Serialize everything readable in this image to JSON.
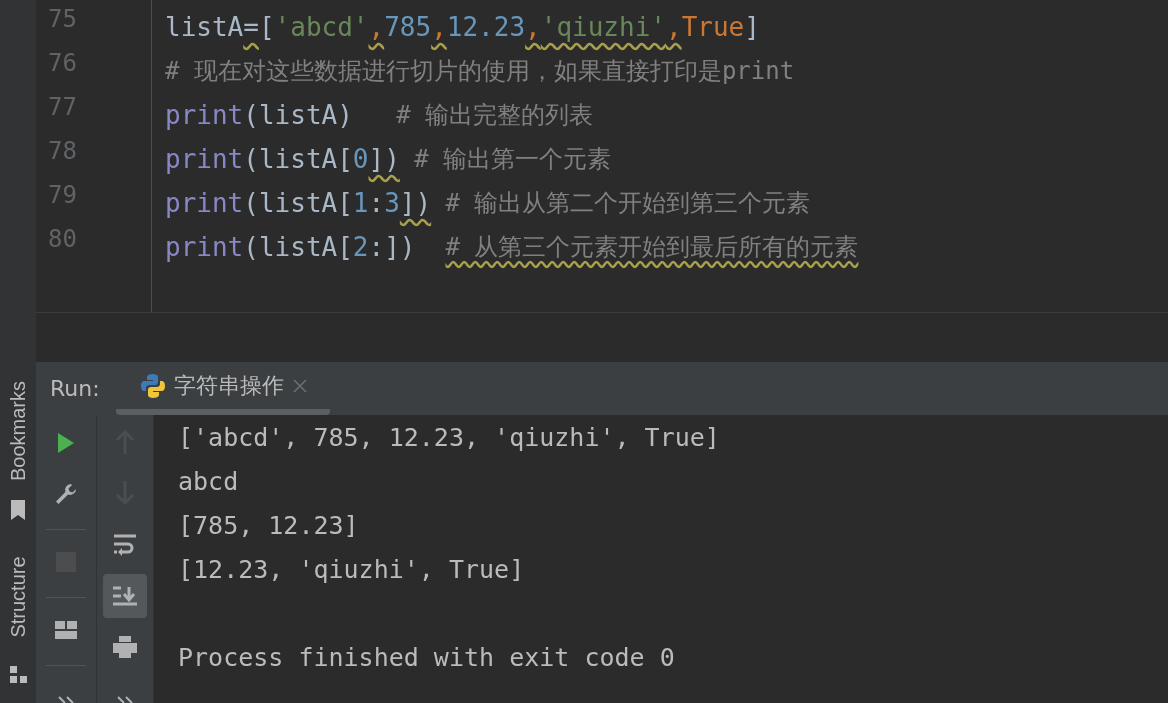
{
  "editor": {
    "lines": [
      {
        "number": "75",
        "tokens": [
          {
            "text": "listA",
            "kind": "plain",
            "warn": false
          },
          {
            "text": "=",
            "kind": "plain",
            "warn": true
          },
          {
            "text": "[",
            "kind": "plain",
            "warn": false
          },
          {
            "text": "'abcd'",
            "kind": "string",
            "warn": false
          },
          {
            "text": ",",
            "kind": "punct",
            "warn": true
          },
          {
            "text": "785",
            "kind": "number",
            "warn": false
          },
          {
            "text": ",",
            "kind": "punct",
            "warn": true
          },
          {
            "text": "12.23",
            "kind": "number",
            "warn": false
          },
          {
            "text": ",",
            "kind": "punct",
            "warn": true
          },
          {
            "text": "'qiuzhi'",
            "kind": "string",
            "warn": true
          },
          {
            "text": ",",
            "kind": "punct",
            "warn": true
          },
          {
            "text": "True",
            "kind": "const",
            "warn": false
          },
          {
            "text": "]",
            "kind": "plain",
            "warn": false
          }
        ]
      },
      {
        "number": "76",
        "tokens": [
          {
            "text": "# 现在对这些数据进行切片的使用，如果直接打印是print",
            "kind": "comment",
            "warn": false
          }
        ]
      },
      {
        "number": "77",
        "tokens": [
          {
            "text": "print",
            "kind": "keyword",
            "warn": false
          },
          {
            "text": "(listA)",
            "kind": "plain",
            "warn": false
          },
          {
            "text": "   # 输出完整的列表",
            "kind": "comment",
            "warn": false
          }
        ]
      },
      {
        "number": "78",
        "tokens": [
          {
            "text": "print",
            "kind": "keyword",
            "warn": false
          },
          {
            "text": "(listA[",
            "kind": "plain",
            "warn": false
          },
          {
            "text": "0",
            "kind": "number",
            "warn": false
          },
          {
            "text": "])",
            "kind": "plain",
            "warn": true
          },
          {
            "text": " # 输出第一个元素",
            "kind": "comment",
            "warn": false
          }
        ]
      },
      {
        "number": "79",
        "tokens": [
          {
            "text": "print",
            "kind": "keyword",
            "warn": false
          },
          {
            "text": "(listA[",
            "kind": "plain",
            "warn": false
          },
          {
            "text": "1",
            "kind": "number",
            "warn": false
          },
          {
            "text": ":",
            "kind": "plain",
            "warn": false
          },
          {
            "text": "3",
            "kind": "number",
            "warn": false
          },
          {
            "text": "])",
            "kind": "plain",
            "warn": true
          },
          {
            "text": " # 输出从第二个开始到第三个元素",
            "kind": "comment",
            "warn": false
          }
        ]
      },
      {
        "number": "80",
        "tokens": [
          {
            "text": "print",
            "kind": "keyword",
            "warn": false
          },
          {
            "text": "(listA[",
            "kind": "plain",
            "warn": false
          },
          {
            "text": "2",
            "kind": "number",
            "warn": false
          },
          {
            "text": ":])",
            "kind": "plain",
            "warn": false
          },
          {
            "text": "# 从第三个元素开始到最后所有的元素",
            "kind": "comment",
            "warn": true
          }
        ]
      }
    ]
  },
  "side_tabs": [
    {
      "label": "Bookmarks",
      "kind": "bookmark"
    },
    {
      "label": "Structure",
      "kind": "structure"
    }
  ],
  "run": {
    "title": "Run:",
    "tabs": [
      {
        "label": "字符串操作",
        "selected": true
      }
    ],
    "toolbar_1": [
      {
        "kind": "run",
        "disabled": false,
        "pressed": false
      },
      {
        "kind": "wrench",
        "disabled": false,
        "pressed": false
      },
      {
        "kind": "separator"
      },
      {
        "kind": "stop",
        "disabled": true,
        "pressed": false
      },
      {
        "kind": "separator"
      },
      {
        "kind": "layout",
        "disabled": false,
        "pressed": false
      },
      {
        "kind": "separator"
      },
      {
        "kind": "more",
        "disabled": false,
        "pressed": false
      }
    ],
    "toolbar_2": [
      {
        "kind": "up",
        "disabled": true,
        "pressed": false
      },
      {
        "kind": "down",
        "disabled": true,
        "pressed": false
      },
      {
        "kind": "wrap",
        "disabled": false,
        "pressed": false
      },
      {
        "kind": "scroll_end",
        "disabled": false,
        "pressed": true
      },
      {
        "kind": "print",
        "disabled": false,
        "pressed": false
      },
      {
        "kind": "more",
        "disabled": false,
        "pressed": false
      }
    ],
    "output": [
      {
        "text": "['abcd', 785, 12.23, 'qiuzhi', True]",
        "gap_before": false
      },
      {
        "text": "abcd",
        "gap_before": false
      },
      {
        "text": "[785, 12.23]",
        "gap_before": false
      },
      {
        "text": "[12.23, 'qiuzhi', True]",
        "gap_before": false
      },
      {
        "text": "Process finished with exit code 0",
        "gap_before": true
      }
    ]
  }
}
